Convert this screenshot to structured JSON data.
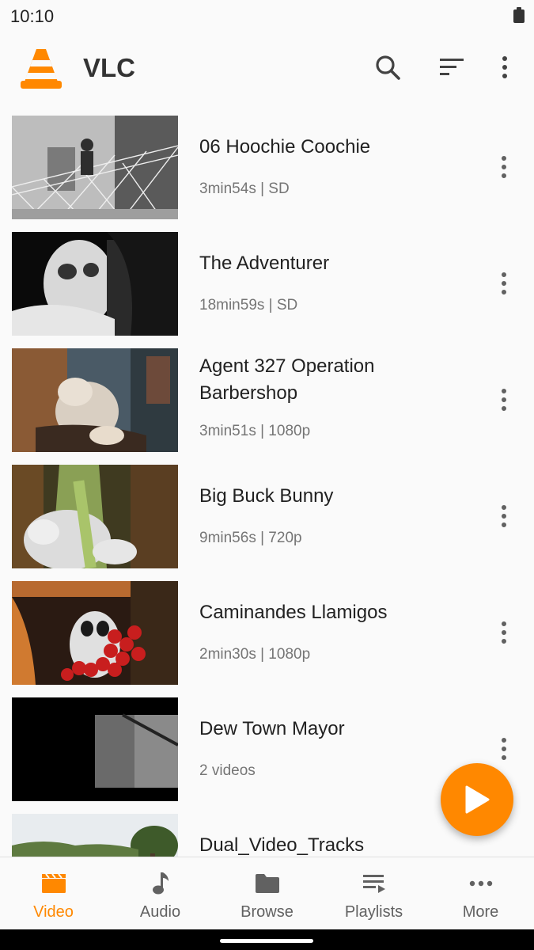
{
  "status_bar": {
    "time": "10:10"
  },
  "app_bar": {
    "title": "VLC"
  },
  "videos": [
    {
      "title": "06 Hoochie Coochie",
      "subtitle": "3min54s | SD"
    },
    {
      "title": "The Adventurer",
      "subtitle": "18min59s | SD"
    },
    {
      "title": "Agent 327 Operation Barbershop",
      "subtitle": "3min51s | 1080p"
    },
    {
      "title": "Big Buck Bunny",
      "subtitle": "9min56s | 720p"
    },
    {
      "title": "Caminandes Llamigos",
      "subtitle": "2min30s | 1080p"
    },
    {
      "title": "Dew Town Mayor",
      "subtitle": "2 videos"
    },
    {
      "title": "Dual_Video_Tracks",
      "subtitle": ""
    }
  ],
  "bottom_nav": {
    "items": [
      {
        "label": "Video",
        "icon": "clapperboard-icon",
        "active": true
      },
      {
        "label": "Audio",
        "icon": "music-note-icon"
      },
      {
        "label": "Browse",
        "icon": "folder-icon"
      },
      {
        "label": "Playlists",
        "icon": "playlist-icon"
      },
      {
        "label": "More",
        "icon": "more-horizontal-icon"
      }
    ]
  },
  "colors": {
    "accent": "#ff8800",
    "text_primary": "#212121",
    "text_secondary": "#757575"
  }
}
